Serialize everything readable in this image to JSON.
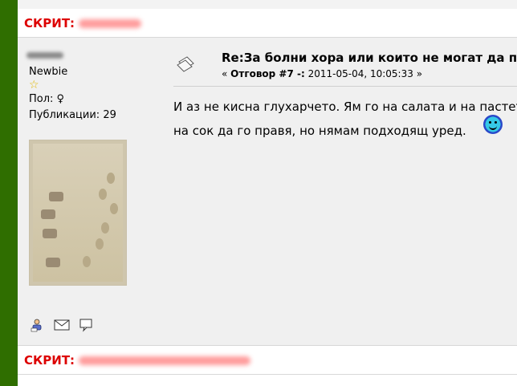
{
  "hidden_header_top": {
    "label": "СКРИТ:"
  },
  "poster": {
    "rank": "Newbie",
    "gender_label": "Пол: ♀",
    "posts_label": "Публикации: 29"
  },
  "post": {
    "subject": "Re:За болни хора или които не могат да п",
    "meta_prefix": "« ",
    "meta_reply": "Отговор #7 -:",
    "meta_date": " 2011-05-04, 10:05:33 »",
    "message_line1": "И аз не кисна глухарчето. Ям го на салата и на пастет",
    "message_line2": "на сок да го правя, но нямам подходящ уред."
  },
  "hidden_header_bottom": {
    "label": "СКРИТ:"
  },
  "icons": [
    "profile-icon",
    "email-icon",
    "quote-icon",
    "smiley-icon",
    "post-icon",
    "star-icon"
  ],
  "colors": {
    "left_bar": "#2f6e00",
    "hidden_label": "#dd0000",
    "post_bg": "#f0f0f0"
  }
}
